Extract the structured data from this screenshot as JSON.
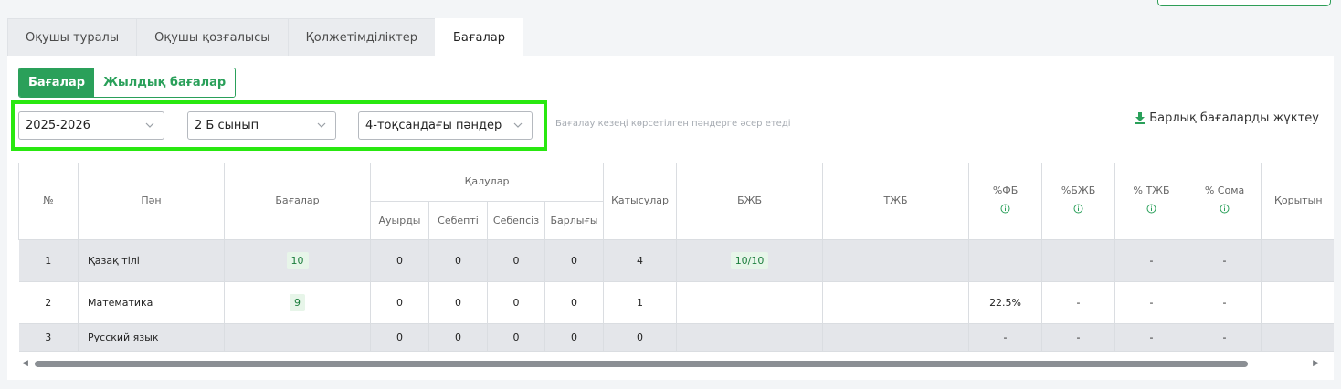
{
  "tabs": [
    "Оқушы туралы",
    "Оқушы қозғалысы",
    "Қолжетімділіктер",
    "Бағалар"
  ],
  "segment": {
    "grades": "Бағалар",
    "yearly": "Жылдық бағалар"
  },
  "filters": {
    "year": "2025-2026",
    "class": "2 Б сынып",
    "quarter": "4-тоқсандағы пәндер"
  },
  "hint": "Бағалау кезеңі көрсетілген пәндерге әсер етеді",
  "download_label": "Барлық бағаларды жүктеу",
  "table": {
    "headers": {
      "no": "№",
      "subject": "Пән",
      "grades": "Бағалар",
      "absences": "Қалулар",
      "sick": "Ауырды",
      "valid": "Себепті",
      "invalid": "Себепсіз",
      "total": "Барлығы",
      "attendance": "Қатысулар",
      "bzb": "БЖБ",
      "tzb": "ТЖБ",
      "pct_fb": "%ФБ",
      "pct_bzb": "%БЖБ",
      "pct_tzb": "% ТЖБ",
      "pct_sum": "% Сома",
      "final": "Қорытын"
    },
    "rows": [
      {
        "no": "1",
        "subject": "Қазақ тілі",
        "grades": "10",
        "sick": "0",
        "valid": "0",
        "invalid": "0",
        "total": "0",
        "attendance": "4",
        "bzb": "10/10",
        "tzb": "",
        "pct_fb": "",
        "pct_bzb": "",
        "pct_tzb": "-",
        "pct_sum": "-"
      },
      {
        "no": "2",
        "subject": "Математика",
        "grades": "9",
        "sick": "0",
        "valid": "0",
        "invalid": "0",
        "total": "0",
        "attendance": "1",
        "bzb": "",
        "tzb": "",
        "pct_fb": "22.5%",
        "pct_bzb": "-",
        "pct_tzb": "-",
        "pct_sum": "-"
      },
      {
        "no": "3",
        "subject": "Русский язык",
        "grades": "",
        "sick": "0",
        "valid": "0",
        "invalid": "0",
        "total": "0",
        "attendance": "0",
        "bzb": "",
        "tzb": "",
        "pct_fb": "-",
        "pct_bzb": "-",
        "pct_tzb": "-",
        "pct_sum": "-"
      }
    ]
  },
  "colors": {
    "accent": "#2aa05a",
    "highlight": "#29e810"
  }
}
